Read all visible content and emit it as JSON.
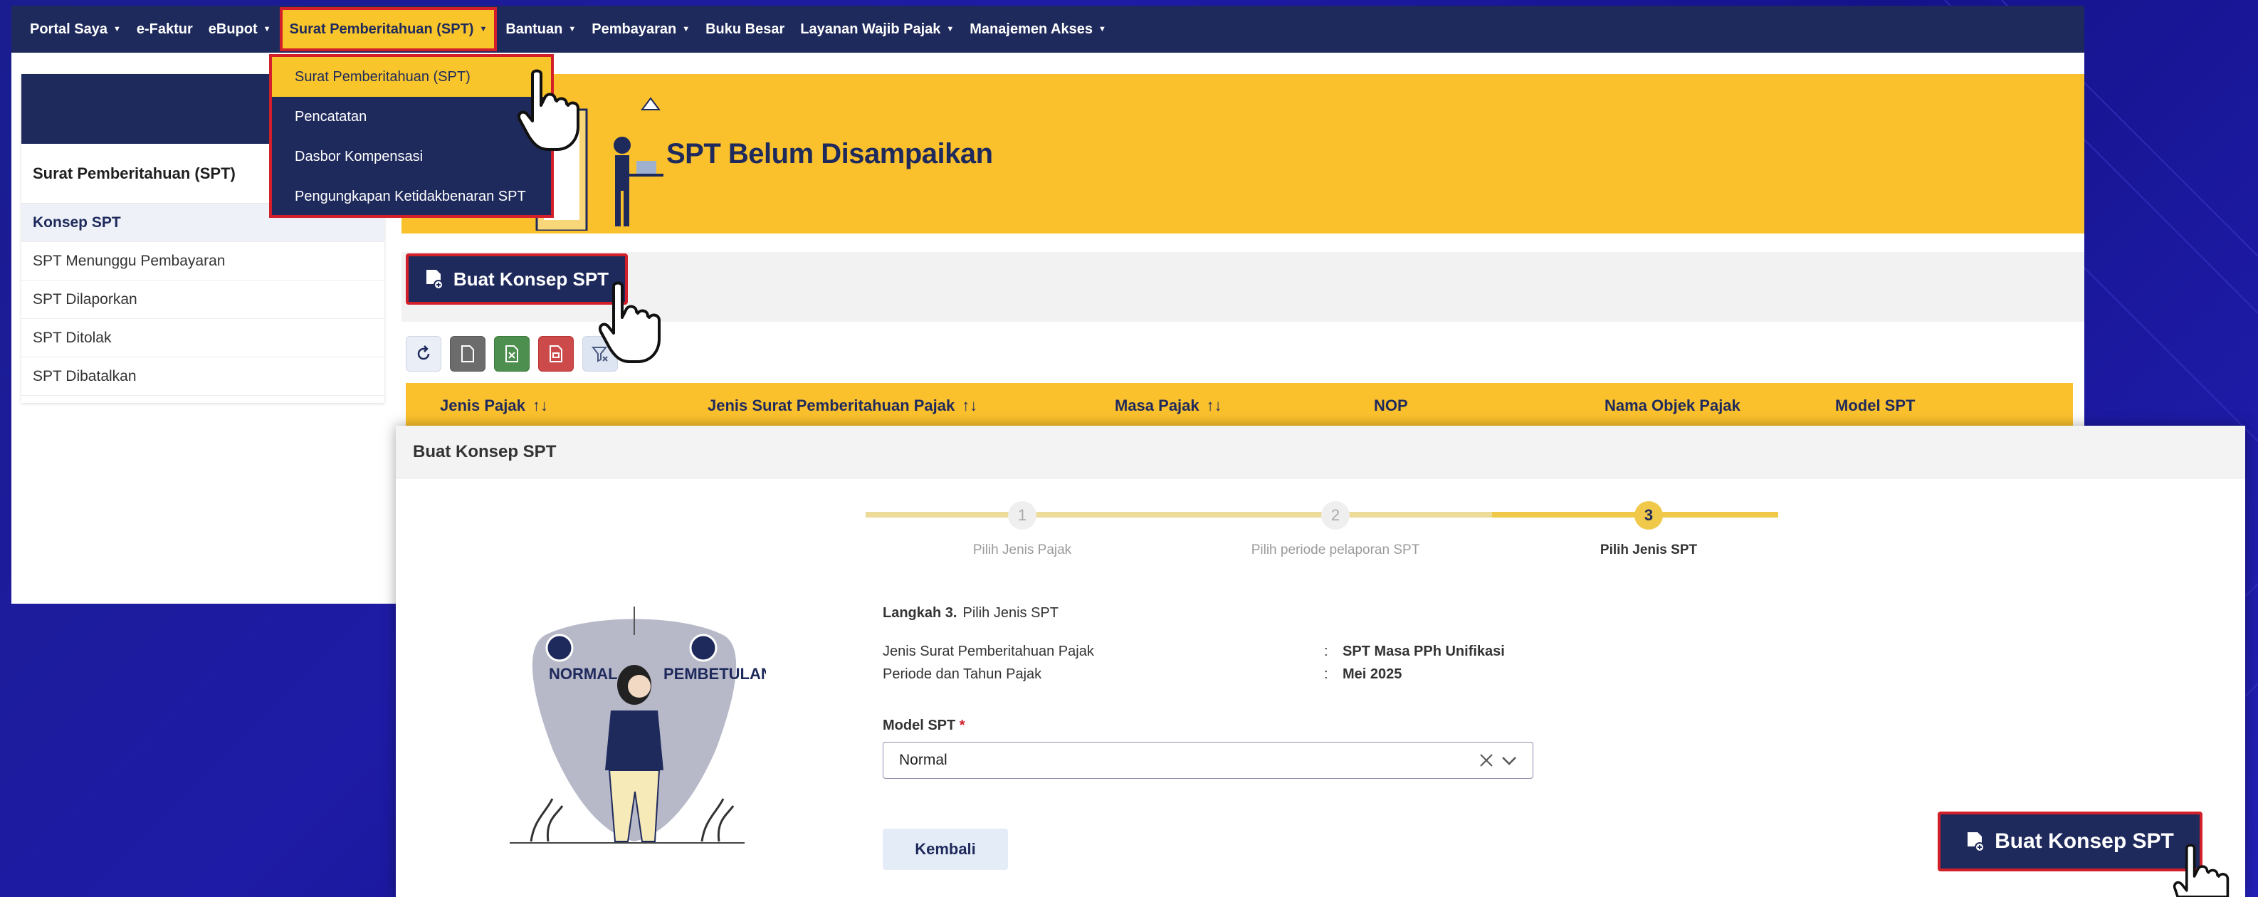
{
  "nav": {
    "items": [
      {
        "label": "Portal Saya",
        "caret": true
      },
      {
        "label": "e-Faktur",
        "caret": false
      },
      {
        "label": "eBupot",
        "caret": true
      },
      {
        "label": "Surat Pemberitahuan (SPT)",
        "caret": true,
        "active": true
      },
      {
        "label": "Bantuan",
        "caret": true
      },
      {
        "label": "Pembayaran",
        "caret": true
      },
      {
        "label": "Buku Besar",
        "caret": false
      },
      {
        "label": "Layanan Wajib Pajak",
        "caret": true
      },
      {
        "label": "Manajemen Akses",
        "caret": true
      }
    ]
  },
  "dropdown": {
    "items": [
      "Surat Pemberitahuan (SPT)",
      "Pencatatan",
      "Dasbor Kompensasi",
      "Pengungkapan Ketidakbenaran SPT"
    ]
  },
  "sidebar": {
    "title": "Surat Pemberitahuan (SPT)",
    "items": [
      "Konsep SPT",
      "SPT Menunggu Pembayaran",
      "SPT Dilaporkan",
      "SPT Ditolak",
      "SPT Dibatalkan"
    ]
  },
  "banner": {
    "title": "SPT Belum Disampaikan"
  },
  "toolbar": {
    "create_label": "Buat Konsep SPT"
  },
  "table": {
    "columns": [
      "Jenis Pajak",
      "Jenis Surat Pemberitahuan Pajak",
      "Masa Pajak",
      "NOP",
      "Nama Objek Pajak",
      "Model SPT"
    ]
  },
  "modal": {
    "title": "Buat Konsep SPT",
    "steps": [
      {
        "number": "1",
        "label": "Pilih Jenis Pajak"
      },
      {
        "number": "2",
        "label": "Pilih periode pelaporan SPT"
      },
      {
        "number": "3",
        "label": "Pilih Jenis SPT"
      }
    ],
    "step_prefix": "Langkah 3.",
    "step_title": "Pilih Jenis SPT",
    "info": [
      {
        "label": "Jenis Surat Pemberitahuan Pajak",
        "value": "SPT Masa PPh Unifikasi"
      },
      {
        "label": "Periode dan Tahun Pajak",
        "value": "Mei 2025"
      }
    ],
    "field_label": "Model SPT",
    "required_mark": "*",
    "selected_value": "Normal",
    "back_label": "Kembali",
    "create_label": "Buat Konsep SPT",
    "illustration_labels": [
      "NORMAL",
      "PEMBETULAN"
    ]
  }
}
